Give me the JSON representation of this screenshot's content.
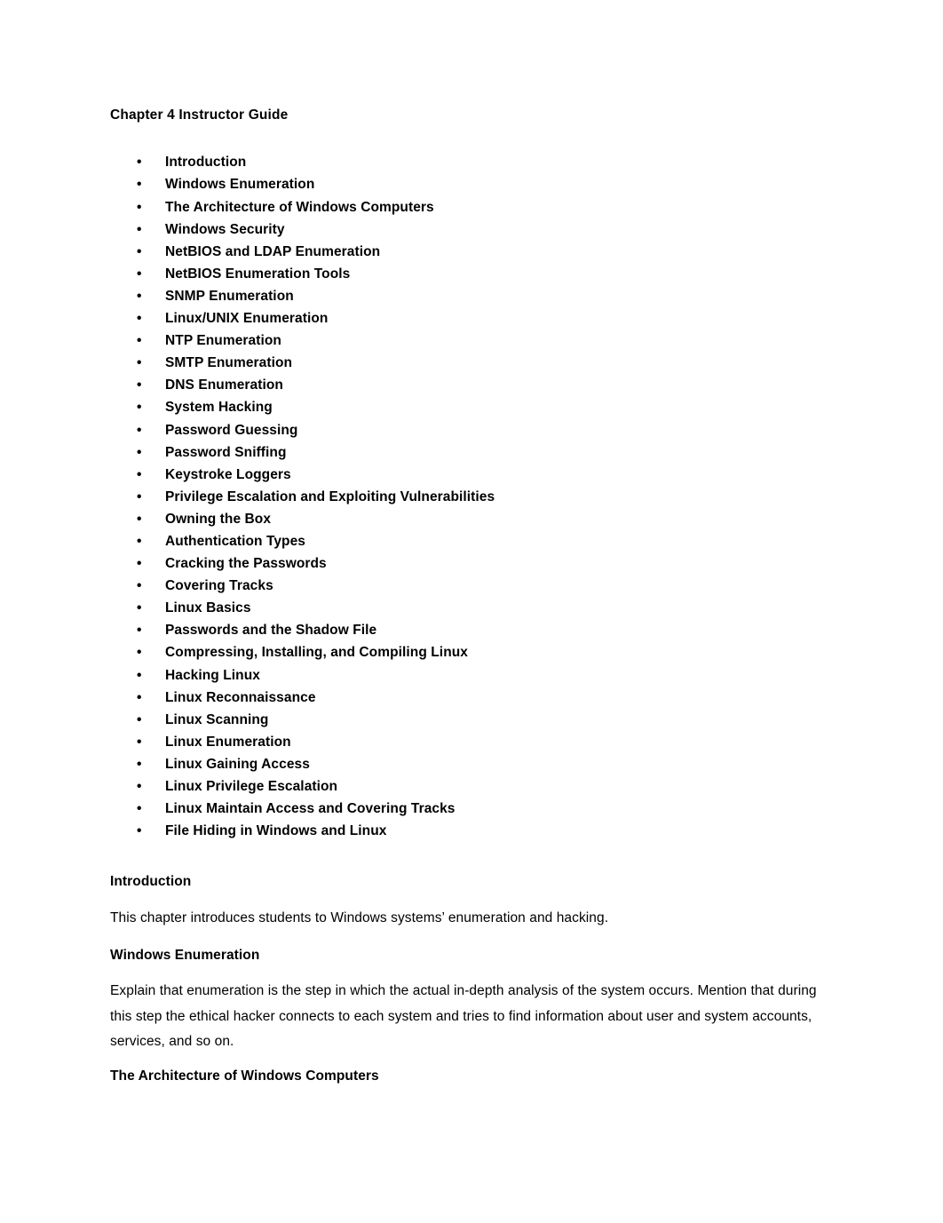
{
  "document": {
    "title": "Chapter 4 Instructor Guide",
    "bullet_glyph": "•",
    "outline": [
      "Introduction",
      "Windows Enumeration",
      "The Architecture of Windows Computers",
      "Windows Security",
      "NetBIOS and LDAP Enumeration",
      "NetBIOS Enumeration Tools",
      "SNMP Enumeration",
      "Linux/UNIX Enumeration",
      "NTP Enumeration",
      "SMTP Enumeration",
      "DNS Enumeration",
      "System Hacking",
      "Password Guessing",
      "Password Sniffing",
      "Keystroke Loggers",
      "Privilege Escalation and Exploiting Vulnerabilities",
      "Owning the Box",
      "Authentication Types",
      "Cracking the Passwords",
      "Covering Tracks",
      "Linux Basics",
      "Passwords and the Shadow File",
      "Compressing, Installing, and Compiling Linux",
      "Hacking Linux",
      "Linux Reconnaissance",
      "Linux Scanning",
      "Linux Enumeration",
      "Linux Gaining Access",
      "Linux Privilege Escalation",
      "Linux Maintain Access and Covering Tracks",
      "File Hiding in Windows and Linux"
    ],
    "sections": [
      {
        "heading": "Introduction",
        "body": "This chapter introduces students to Windows systems’ enumeration and hacking."
      },
      {
        "heading": "Windows Enumeration",
        "body": "Explain that enumeration is the step in which the actual in-depth analysis of the system occurs. Mention that during this step the ethical hacker connects to each system and tries to find information about user and system accounts, services, and so on."
      },
      {
        "heading": "The Architecture of Windows Computers",
        "body": ""
      }
    ]
  }
}
